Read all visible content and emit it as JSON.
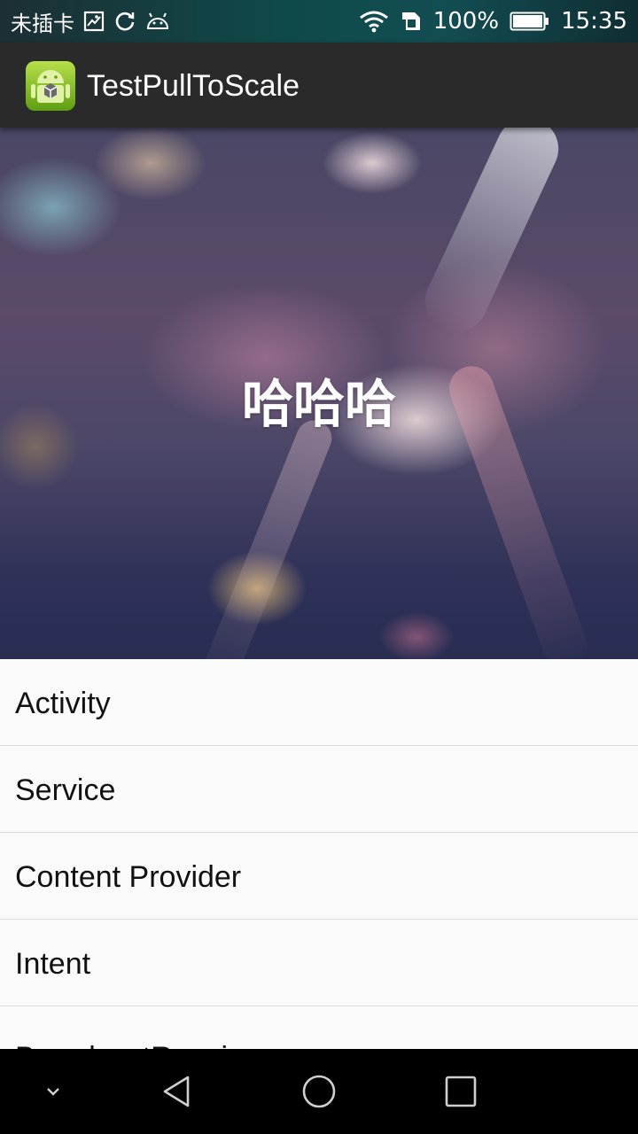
{
  "status_bar": {
    "carrier": "未插卡",
    "battery_percent": "100%",
    "time": "15:35",
    "icons": [
      "image-icon",
      "sync-icon",
      "android-debug-icon",
      "wifi-icon",
      "sim-status-icon",
      "battery-icon"
    ]
  },
  "action_bar": {
    "title": "TestPullToScale",
    "icon": "android-app-icon"
  },
  "header": {
    "text": "哈哈哈"
  },
  "list": {
    "items": [
      "Activity",
      "Service",
      "Content Provider",
      "Intent",
      "BroadcastReceiver"
    ]
  },
  "nav_bar": {
    "icons": [
      "collapse-chevron-icon",
      "back-icon",
      "home-icon",
      "recents-icon"
    ]
  },
  "colors": {
    "action_bar_bg": "#2a2a2a",
    "list_bg": "#fafafa",
    "nav_bar_bg": "#000000",
    "divider": "#dcdcdc"
  }
}
